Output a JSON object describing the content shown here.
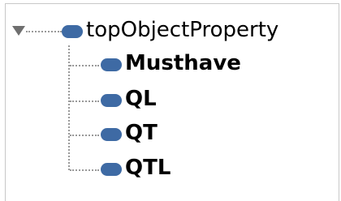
{
  "tree": {
    "root": {
      "label": "topObjectProperty",
      "expanded": true,
      "icon": "object-property-icon",
      "icon_color": "#3e6aa4"
    },
    "children": [
      {
        "label": "Musthave"
      },
      {
        "label": "QL"
      },
      {
        "label": "QT"
      },
      {
        "label": "QTL"
      }
    ]
  }
}
